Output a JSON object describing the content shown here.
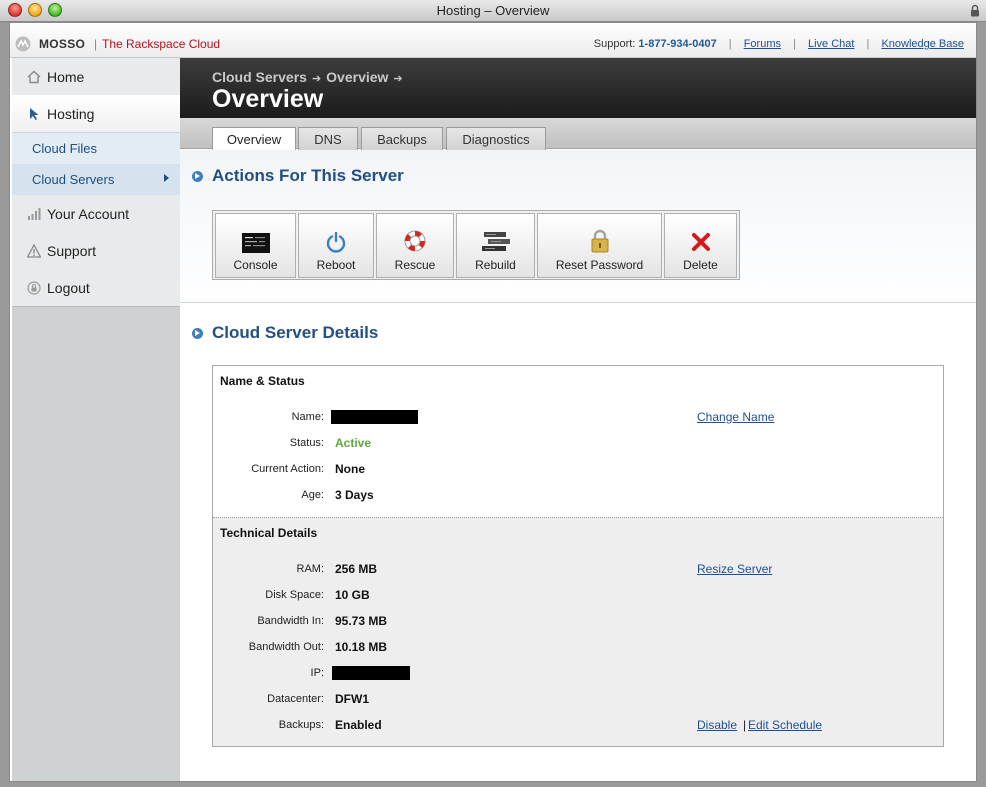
{
  "window": {
    "title": "Hosting – Overview"
  },
  "brand": {
    "name": "MOSSO",
    "separator": "|",
    "tagline": "The Rackspace Cloud"
  },
  "top_links": {
    "support_label": "Support:",
    "phone": "1-877-934-0407",
    "links": [
      "Forums",
      "Live Chat",
      "Knowledge Base"
    ],
    "separator": "|"
  },
  "sidebar": {
    "items": [
      {
        "label": "Home",
        "icon": "home-icon"
      },
      {
        "label": "Hosting",
        "icon": "cursor-icon"
      }
    ],
    "subitems": [
      {
        "label": "Cloud Files"
      },
      {
        "label": "Cloud Servers"
      }
    ],
    "lower_items": [
      {
        "label": "Your Account",
        "icon": "bars-icon"
      },
      {
        "label": "Support",
        "icon": "warning-icon"
      },
      {
        "label": "Logout",
        "icon": "lock-icon"
      }
    ]
  },
  "header": {
    "breadcrumb": [
      "Cloud Servers",
      "Overview"
    ],
    "breadcrumb_arrow": "➔",
    "title": "Overview"
  },
  "tabs": [
    "Overview",
    "DNS",
    "Backups",
    "Diagnostics"
  ],
  "actions_section": {
    "title": "Actions For This Server",
    "buttons": [
      {
        "label": "Console",
        "icon": "terminal-icon"
      },
      {
        "label": "Reboot",
        "icon": "power-icon"
      },
      {
        "label": "Rescue",
        "icon": "lifebuoy-icon"
      },
      {
        "label": "Rebuild",
        "icon": "server-stack-icon"
      },
      {
        "label": "Reset Password",
        "icon": "padlock-icon"
      },
      {
        "label": "Delete",
        "icon": "red-x-icon"
      }
    ]
  },
  "details_section": {
    "title": "Cloud Server Details",
    "name_status": {
      "title": "Name & Status",
      "rows": [
        {
          "label": "Name:",
          "value": "",
          "redacted": true
        },
        {
          "label": "Status:",
          "value": "Active"
        },
        {
          "label": "Current Action:",
          "value": "None"
        },
        {
          "label": "Age:",
          "value": "3 Days"
        }
      ],
      "change_name_link": "Change Name"
    },
    "technical": {
      "title": "Technical Details",
      "rows": [
        {
          "label": "RAM:",
          "value": "256 MB"
        },
        {
          "label": "Disk Space:",
          "value": "10 GB"
        },
        {
          "label": "Bandwidth In:",
          "value": "95.73 MB"
        },
        {
          "label": "Bandwidth Out:",
          "value": "10.18 MB"
        },
        {
          "label": "IP:",
          "value": "",
          "redacted": true
        },
        {
          "label": "Datacenter:",
          "value": "DFW1"
        },
        {
          "label": "Backups:",
          "value": "Enabled"
        }
      ],
      "resize_link": "Resize Server",
      "disable_link": "Disable",
      "link_separator": "|",
      "edit_schedule_link": "Edit Schedule"
    }
  },
  "colors": {
    "accent": "#234f84",
    "brand_red": "#b5121b",
    "status_active": "#5aab3a",
    "link": "#1d4f99"
  }
}
